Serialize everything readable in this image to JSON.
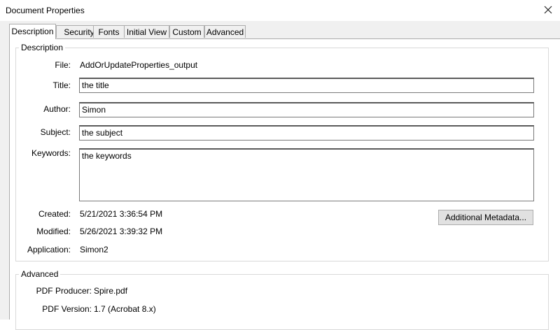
{
  "window": {
    "title": "Document Properties"
  },
  "tabs": [
    "Description",
    "Security",
    "Fonts",
    "Initial View",
    "Custom",
    "Advanced"
  ],
  "description": {
    "legend": "Description",
    "file_label": "File:",
    "file_value": "AddOrUpdateProperties_output",
    "title_label": "Title:",
    "title_value": "the title",
    "author_label": "Author:",
    "author_value": "Simon",
    "subject_label": "Subject:",
    "subject_value": "the subject",
    "keywords_label": "Keywords:",
    "keywords_value": "the keywords",
    "created_label": "Created:",
    "created_value": "5/21/2021 3:36:54 PM",
    "modified_label": "Modified:",
    "modified_value": "5/26/2021 3:39:32 PM",
    "application_label": "Application:",
    "application_value": "Simon2",
    "metadata_button": "Additional Metadata..."
  },
  "advanced": {
    "legend": "Advanced",
    "producer_label": "PDF Producer:",
    "producer_value": "Spire.pdf",
    "version_label": "PDF Version:",
    "version_value": "1.7 (Acrobat 8.x)"
  },
  "icons": {
    "close": "close-icon"
  }
}
